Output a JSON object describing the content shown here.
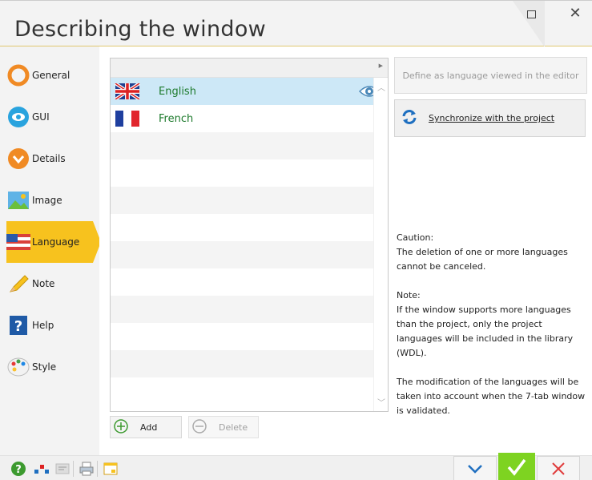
{
  "window": {
    "title": "Describing the window"
  },
  "sidebar": {
    "items": [
      {
        "label": "General",
        "icon": "general-icon"
      },
      {
        "label": "GUI",
        "icon": "gui-icon"
      },
      {
        "label": "Details",
        "icon": "details-icon"
      },
      {
        "label": "Image",
        "icon": "image-icon"
      },
      {
        "label": "Language",
        "icon": "language-icon",
        "active": true
      },
      {
        "label": "Note",
        "icon": "note-icon"
      },
      {
        "label": "Help",
        "icon": "help-icon"
      },
      {
        "label": "Style",
        "icon": "style-icon"
      }
    ]
  },
  "languages": {
    "rows": [
      {
        "name": "English",
        "flag": "uk-flag-icon",
        "viewed": true
      },
      {
        "name": "French",
        "flag": "france-flag-icon",
        "viewed": false
      }
    ]
  },
  "buttons": {
    "define_label": "Define as language viewed in the editor",
    "sync_label": "Synchronize with the project",
    "add_label": "Add",
    "delete_label": "Delete"
  },
  "notes": {
    "caution": "Caution:\nThe deletion of one or more languages cannot be canceled.",
    "note": "Note:\nIf the window supports more languages than the project, only the project languages will be included in the library (WDL).",
    "modification": "The modification of the languages will be taken into account when the 7-tab window is validated."
  },
  "colors": {
    "accent": "#f7c21e",
    "language_text": "#1d7a2c",
    "ok_button": "#7ed321",
    "selected_row": "#cde8f7"
  }
}
